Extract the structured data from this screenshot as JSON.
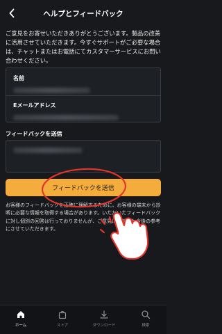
{
  "header": {
    "title": "ヘルプとフィードバック",
    "back_icon": "chevron-left-icon"
  },
  "intro": {
    "text": "ご意見をお寄せいただきありがとうございます。製品の改善に活用させていただきます。今すぐサポートがご必要な場合は、チャットまたはお電話にてカスタマーサービスにお問い合わせください。"
  },
  "form": {
    "name_label": "名前",
    "email_label": "Eメールアドレス",
    "feedback_label": "フィードバックを送信",
    "submit_label": "フィードバックを送信"
  },
  "disclaimer": {
    "text": "お客様のフィードバックを正確に理解するために、お客様の端末から診断に必要な情報を取得する場合があります。いただいたフィードバックに対し個別の回答は行っておりませんが、ご意見はいずれも今後の参考にさせていただきます。"
  },
  "tabbar": {
    "items": [
      {
        "label": "ホーム",
        "icon": "home-icon",
        "active": true
      },
      {
        "label": "ストア",
        "icon": "store-bag-icon",
        "active": false
      },
      {
        "label": "ダウンロード",
        "icon": "download-icon",
        "active": false
      },
      {
        "label": "検索",
        "icon": "search-icon",
        "active": false
      }
    ]
  },
  "colors": {
    "background": "#17191c",
    "accent": "#f4ad3d",
    "annotation": "#e4352d"
  }
}
